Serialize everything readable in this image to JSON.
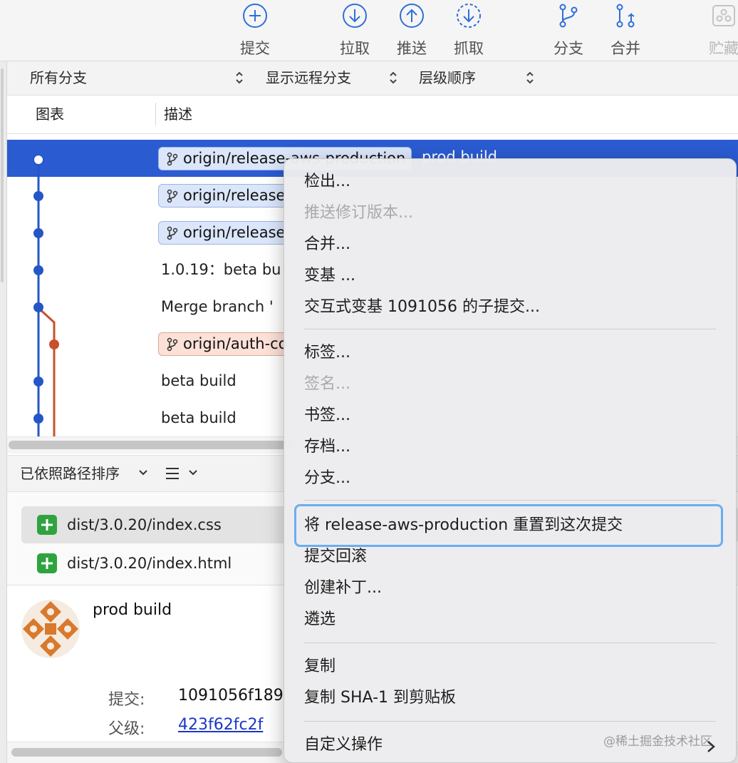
{
  "toolbar": {
    "commit": "提交",
    "pull": "拉取",
    "push": "推送",
    "fetch": "抓取",
    "branch": "分支",
    "merge": "合并",
    "stash": "贮藏"
  },
  "filters": {
    "branches": "所有分支",
    "remote": "显示远程分支",
    "order": "层级顺序"
  },
  "columns": {
    "graph": "图表",
    "description": "描述"
  },
  "commits": [
    {
      "tag": "origin/release-aws-production",
      "after": "prod build"
    },
    {
      "tag": "origin/release"
    },
    {
      "tag": "origin/release"
    },
    {
      "desc": "1.0.19：beta bu"
    },
    {
      "desc": "Merge branch '"
    },
    {
      "tag": "origin/auth-co"
    },
    {
      "desc": "beta build"
    },
    {
      "desc": "beta build"
    }
  ],
  "files_bar": {
    "sort_label": "已依照路径排序"
  },
  "files": [
    {
      "path": "dist/3.0.20/index.css"
    },
    {
      "path": "dist/3.0.20/index.html"
    }
  ],
  "details": {
    "message": "prod build",
    "commit_label": "提交:",
    "commit_value": "1091056f189",
    "parent_label": "父级:",
    "parent_value": "423f62fc2f"
  },
  "menu": {
    "checkout": "检出...",
    "push_revision": "推送修订版本...",
    "merge": "合并...",
    "rebase": "变基 ...",
    "interactive_rebase": "交互式变基 1091056 的子提交...",
    "tag": "标签...",
    "sign": "签名...",
    "bookmark": "书签...",
    "archive": "存档...",
    "branch": "分支...",
    "reset": "将 release-aws-production 重置到这次提交",
    "revert": "提交回滚",
    "create_patch": "创建补丁...",
    "cherry_pick": "遴选",
    "copy": "复制",
    "copy_sha": "复制 SHA-1 到剪贴板",
    "custom_actions": "自定义操作"
  },
  "watermark": "@稀土掘金技术社区",
  "colors": {
    "selection": "#2b5bd1",
    "graph_blue": "#2456c6",
    "graph_red": "#c9502a",
    "focus_ring": "#6aaef0",
    "add_green": "#2fa33f"
  }
}
